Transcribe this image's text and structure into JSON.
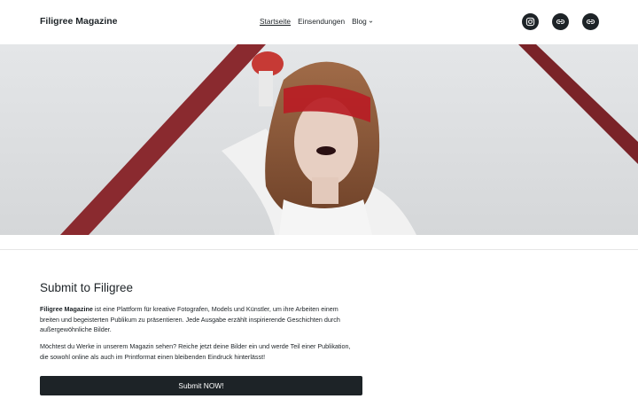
{
  "site": {
    "title": "Filigree Magazine"
  },
  "nav": {
    "items": [
      {
        "label": "Startseite"
      },
      {
        "label": "Einsendungen"
      },
      {
        "label": "Blog"
      }
    ]
  },
  "social": {
    "icons": [
      "instagram-icon",
      "link-icon",
      "link-icon"
    ]
  },
  "main": {
    "heading": "Submit to Filigree",
    "para1_brand": "Filigree Magazine",
    "para1_rest": " ist eine Plattform für kreative Fotografen, Models und Künstler, um ihre Arbeiten einem breiten und begeisterten Publikum zu präsentieren. Jede Ausgabe erzählt inspirierende Geschichten durch außergewöhnliche Bilder.",
    "para2": "Möchtest du Werke in unserem Magazin sehen? Reiche jetzt deine Bilder ein und werde Teil einer Publikation, die sowohl online als auch im Printformat einen bleibenden Eindruck hinterlässt!",
    "cta": "Submit NOW!"
  },
  "colors": {
    "text": "#1d2327",
    "button": "#1d2327",
    "beam": "#7a2328",
    "blindfold": "#b81d24"
  }
}
